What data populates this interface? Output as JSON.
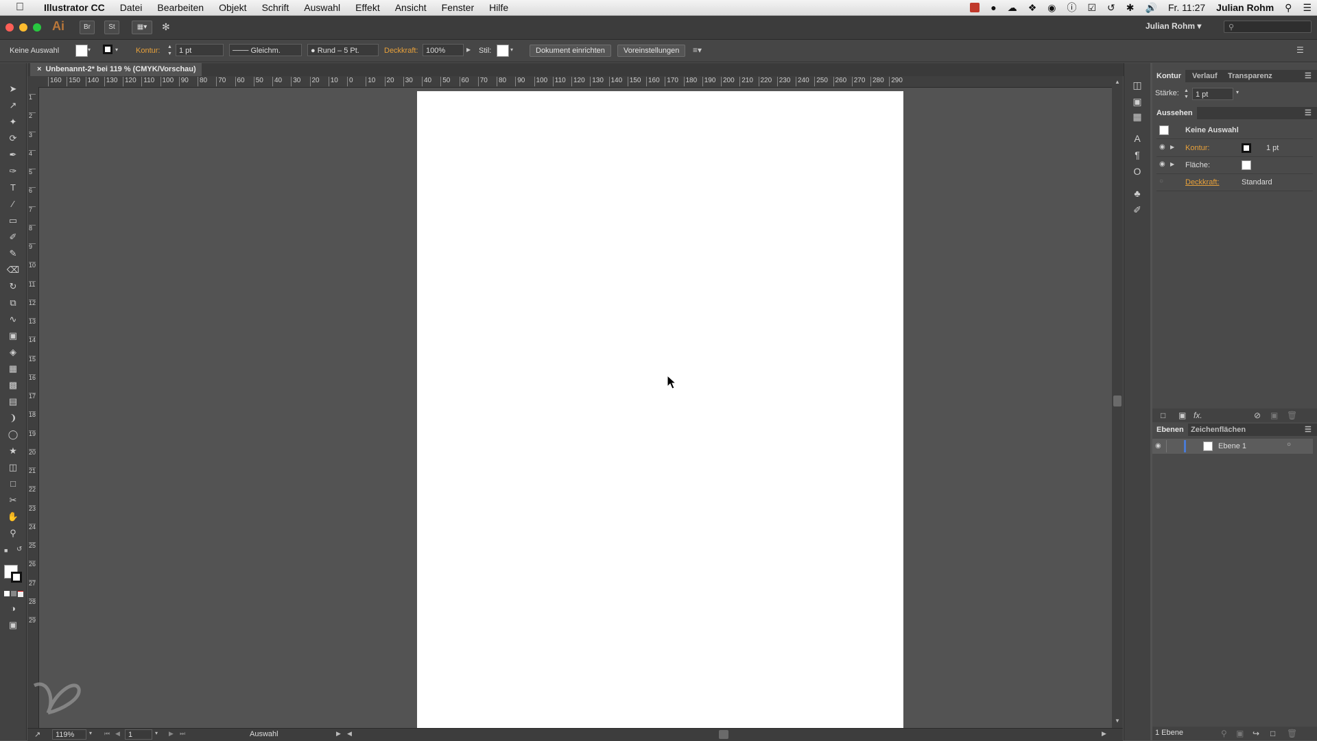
{
  "menubar": {
    "app_name": "Illustrator CC",
    "menus": [
      "Datei",
      "Bearbeiten",
      "Objekt",
      "Schrift",
      "Auswahl",
      "Effekt",
      "Ansicht",
      "Fenster",
      "Hilfe"
    ],
    "clock": "Fr. 11:27",
    "user": "Julian Rohm"
  },
  "appbar": {
    "logo": "Ai",
    "bridge_label": "Br",
    "stock_label": "St",
    "user_menu": "Julian Rohm"
  },
  "control": {
    "selection_label": "Keine Auswahl",
    "kontur_label": "Kontur:",
    "stroke_weight": "1 pt",
    "stroke_profile": "Gleichm.",
    "brush": "Rund – 5 Pt.",
    "deckkraft_label": "Deckkraft:",
    "opacity": "100%",
    "stil_label": "Stil:",
    "doc_setup_button": "Dokument einrichten",
    "prefs_button": "Voreinstellungen"
  },
  "document": {
    "tab_title": "Unbenannt-2* bei 119 % (CMYK/Vorschau)",
    "zoom": "119%",
    "artboard_number": "1",
    "status_tool": "Auswahl"
  },
  "ruler": {
    "h_labels": [
      "160",
      "150",
      "140",
      "130",
      "120",
      "110",
      "100",
      "90",
      "80",
      "70",
      "60",
      "50",
      "40",
      "30",
      "20",
      "10",
      "0",
      "10",
      "20",
      "30",
      "40",
      "50",
      "60",
      "70",
      "80",
      "90",
      "100",
      "110",
      "120",
      "130",
      "140",
      "150",
      "160",
      "170",
      "180",
      "190",
      "200",
      "210",
      "220",
      "230",
      "240",
      "250",
      "260",
      "270",
      "280",
      "290"
    ],
    "v_labels": [
      "1",
      "2",
      "3",
      "4",
      "5",
      "6",
      "7",
      "8",
      "9",
      "10",
      "11",
      "12",
      "13",
      "14",
      "15",
      "16",
      "17",
      "18",
      "19",
      "20",
      "21",
      "22",
      "23",
      "24",
      "25",
      "26",
      "27",
      "28",
      "29"
    ]
  },
  "kontur_panel": {
    "tabs": [
      "Kontur",
      "Verlauf",
      "Transparenz"
    ],
    "staerke_label": "Stärke:",
    "staerke_value": "1 pt"
  },
  "aussehen_panel": {
    "title": "Aussehen",
    "header": "Keine Auswahl",
    "rows": [
      {
        "label": "Kontur:",
        "value": "1 pt"
      },
      {
        "label": "Fläche:",
        "value": ""
      },
      {
        "label": "Deckkraft:",
        "value": "Standard"
      }
    ],
    "fx_label": "fx."
  },
  "ebenen_panel": {
    "tabs": [
      "Ebenen",
      "Zeichenflächen"
    ],
    "layer_name": "Ebene 1",
    "footer": "1 Ebene"
  },
  "colors": {
    "accent_orange": "#e8a13a",
    "layer_color": "#4a7bd4"
  }
}
